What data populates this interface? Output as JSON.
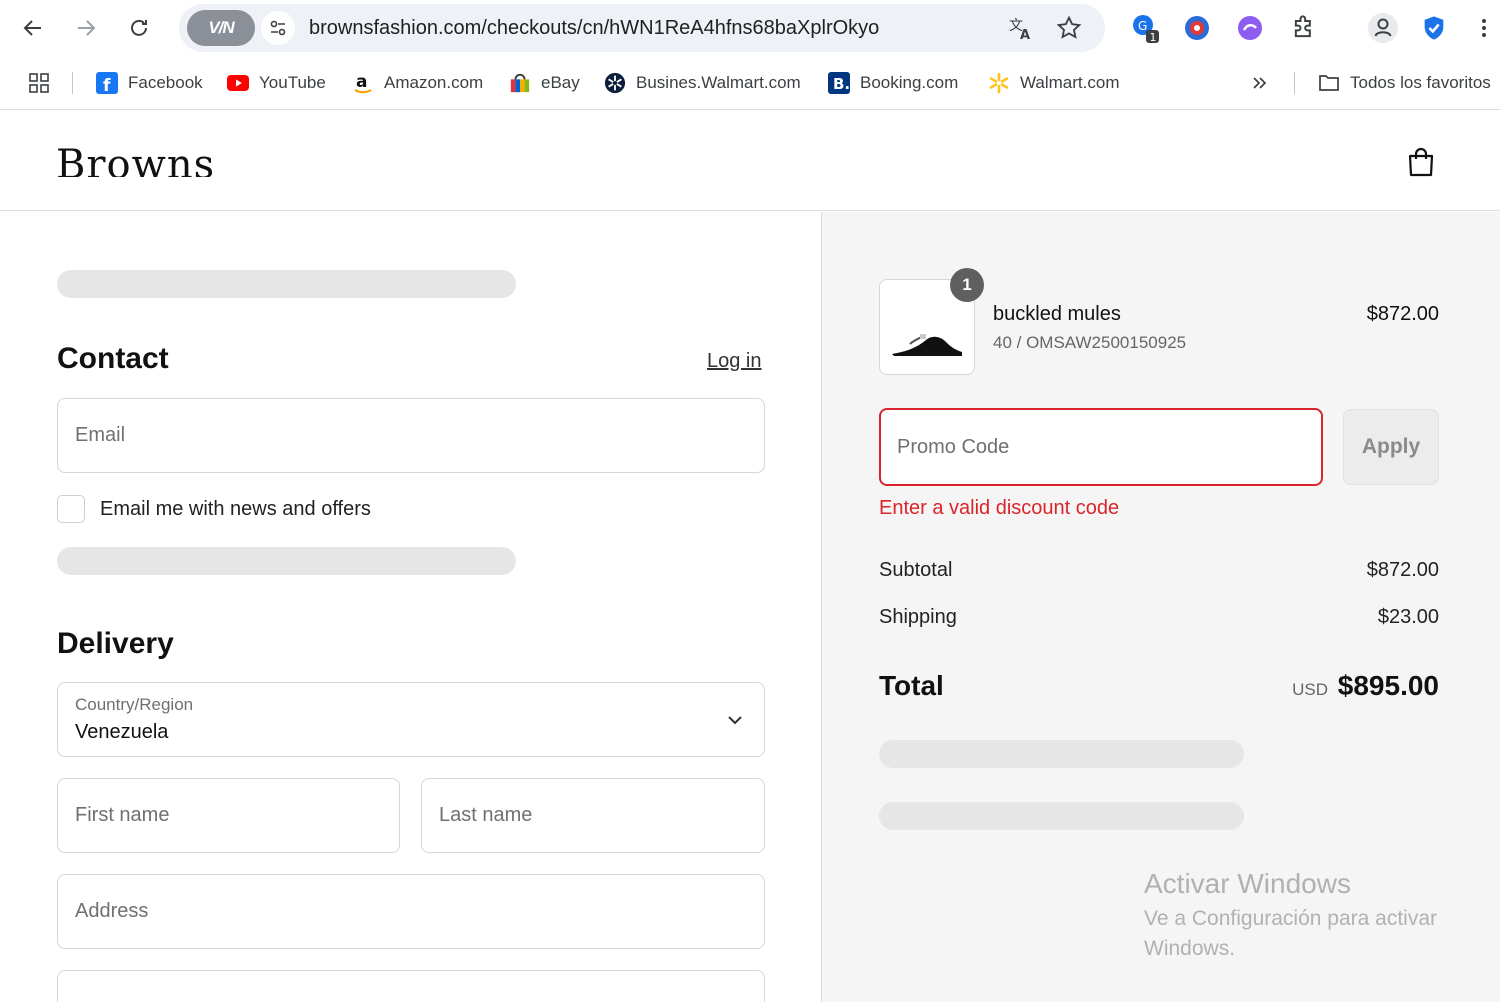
{
  "browser": {
    "url": "brownsfashion.com/checkouts/cn/hWN1ReA4hfns68baXplrOkyo",
    "vpn_label": "V/N",
    "extension_badge": "1",
    "bookmarks": [
      {
        "label": "Facebook",
        "icon": "facebook-icon"
      },
      {
        "label": "YouTube",
        "icon": "youtube-icon"
      },
      {
        "label": "Amazon.com",
        "icon": "amazon-icon"
      },
      {
        "label": "eBay",
        "icon": "ebay-icon"
      },
      {
        "label": "Busines.Walmart.com",
        "icon": "walmart-business-icon"
      },
      {
        "label": "Booking.com",
        "icon": "booking-icon"
      },
      {
        "label": "Walmart.com",
        "icon": "walmart-icon"
      }
    ],
    "all_bookmarks_label": "Todos los favoritos"
  },
  "site": {
    "logo": "Browns"
  },
  "contact": {
    "title": "Contact",
    "login_link": "Log in",
    "email_placeholder": "Email",
    "newsletter_label": "Email me with news and offers"
  },
  "delivery": {
    "title": "Delivery",
    "country_label": "Country/Region",
    "country_value": "Venezuela",
    "first_name_placeholder": "First name",
    "last_name_placeholder": "Last name",
    "address_placeholder": "Address"
  },
  "order": {
    "item": {
      "quantity": "1",
      "name": "buckled mules",
      "variant": "40 / OMSAW2500150925",
      "price": "$872.00"
    },
    "promo_placeholder": "Promo Code",
    "apply_label": "Apply",
    "promo_error": "Enter a valid discount code",
    "subtotal_label": "Subtotal",
    "subtotal_value": "$872.00",
    "shipping_label": "Shipping",
    "shipping_value": "$23.00",
    "total_label": "Total",
    "total_currency": "USD",
    "total_value": "$895.00"
  },
  "watermark": {
    "title": "Activar Windows",
    "subtitle": "Ve a Configuración para activar Windows."
  },
  "colors": {
    "error_red": "#d9252a",
    "summary_bg": "#f5f5f5",
    "skeleton": "#e6e6e6"
  }
}
